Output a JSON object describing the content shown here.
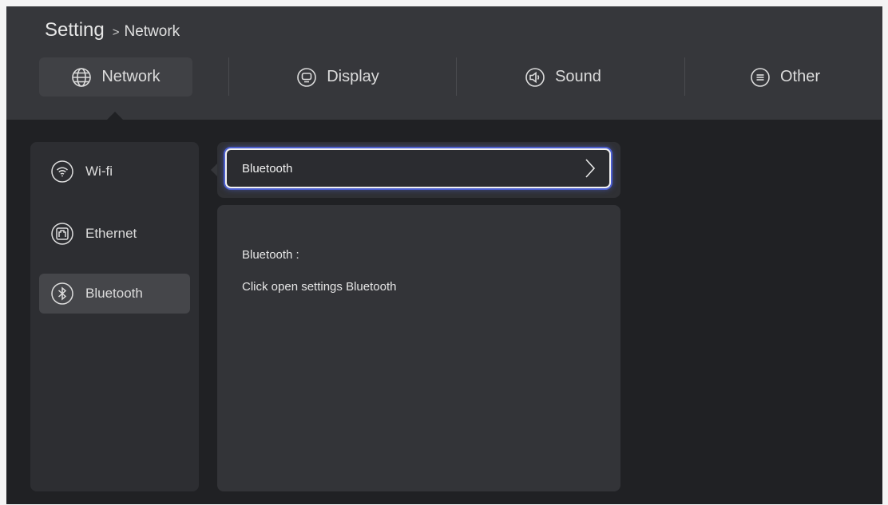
{
  "breadcrumb": {
    "root": "Setting",
    "separator": ">",
    "current": "Network"
  },
  "tabs": [
    {
      "label": "Network",
      "icon": "globe-icon",
      "active": true
    },
    {
      "label": "Display",
      "icon": "display-icon",
      "active": false
    },
    {
      "label": "Sound",
      "icon": "speaker-icon",
      "active": false
    },
    {
      "label": "Other",
      "icon": "menu-icon",
      "active": false
    }
  ],
  "sidebar": {
    "items": [
      {
        "label": "Wi-fi",
        "icon": "wifi-icon",
        "active": false
      },
      {
        "label": "Ethernet",
        "icon": "ethernet-icon",
        "active": false
      },
      {
        "label": "Bluetooth",
        "icon": "bluetooth-icon",
        "active": true
      }
    ]
  },
  "selector": {
    "label": "Bluetooth",
    "icon": "chevron-right-icon"
  },
  "info": {
    "title": "Bluetooth :",
    "description": "Click open settings Bluetooth"
  },
  "colors": {
    "background": "#202124",
    "topbar": "#36373b",
    "focus_ring": "#4c5fd0",
    "text": "#e6e6e6"
  }
}
